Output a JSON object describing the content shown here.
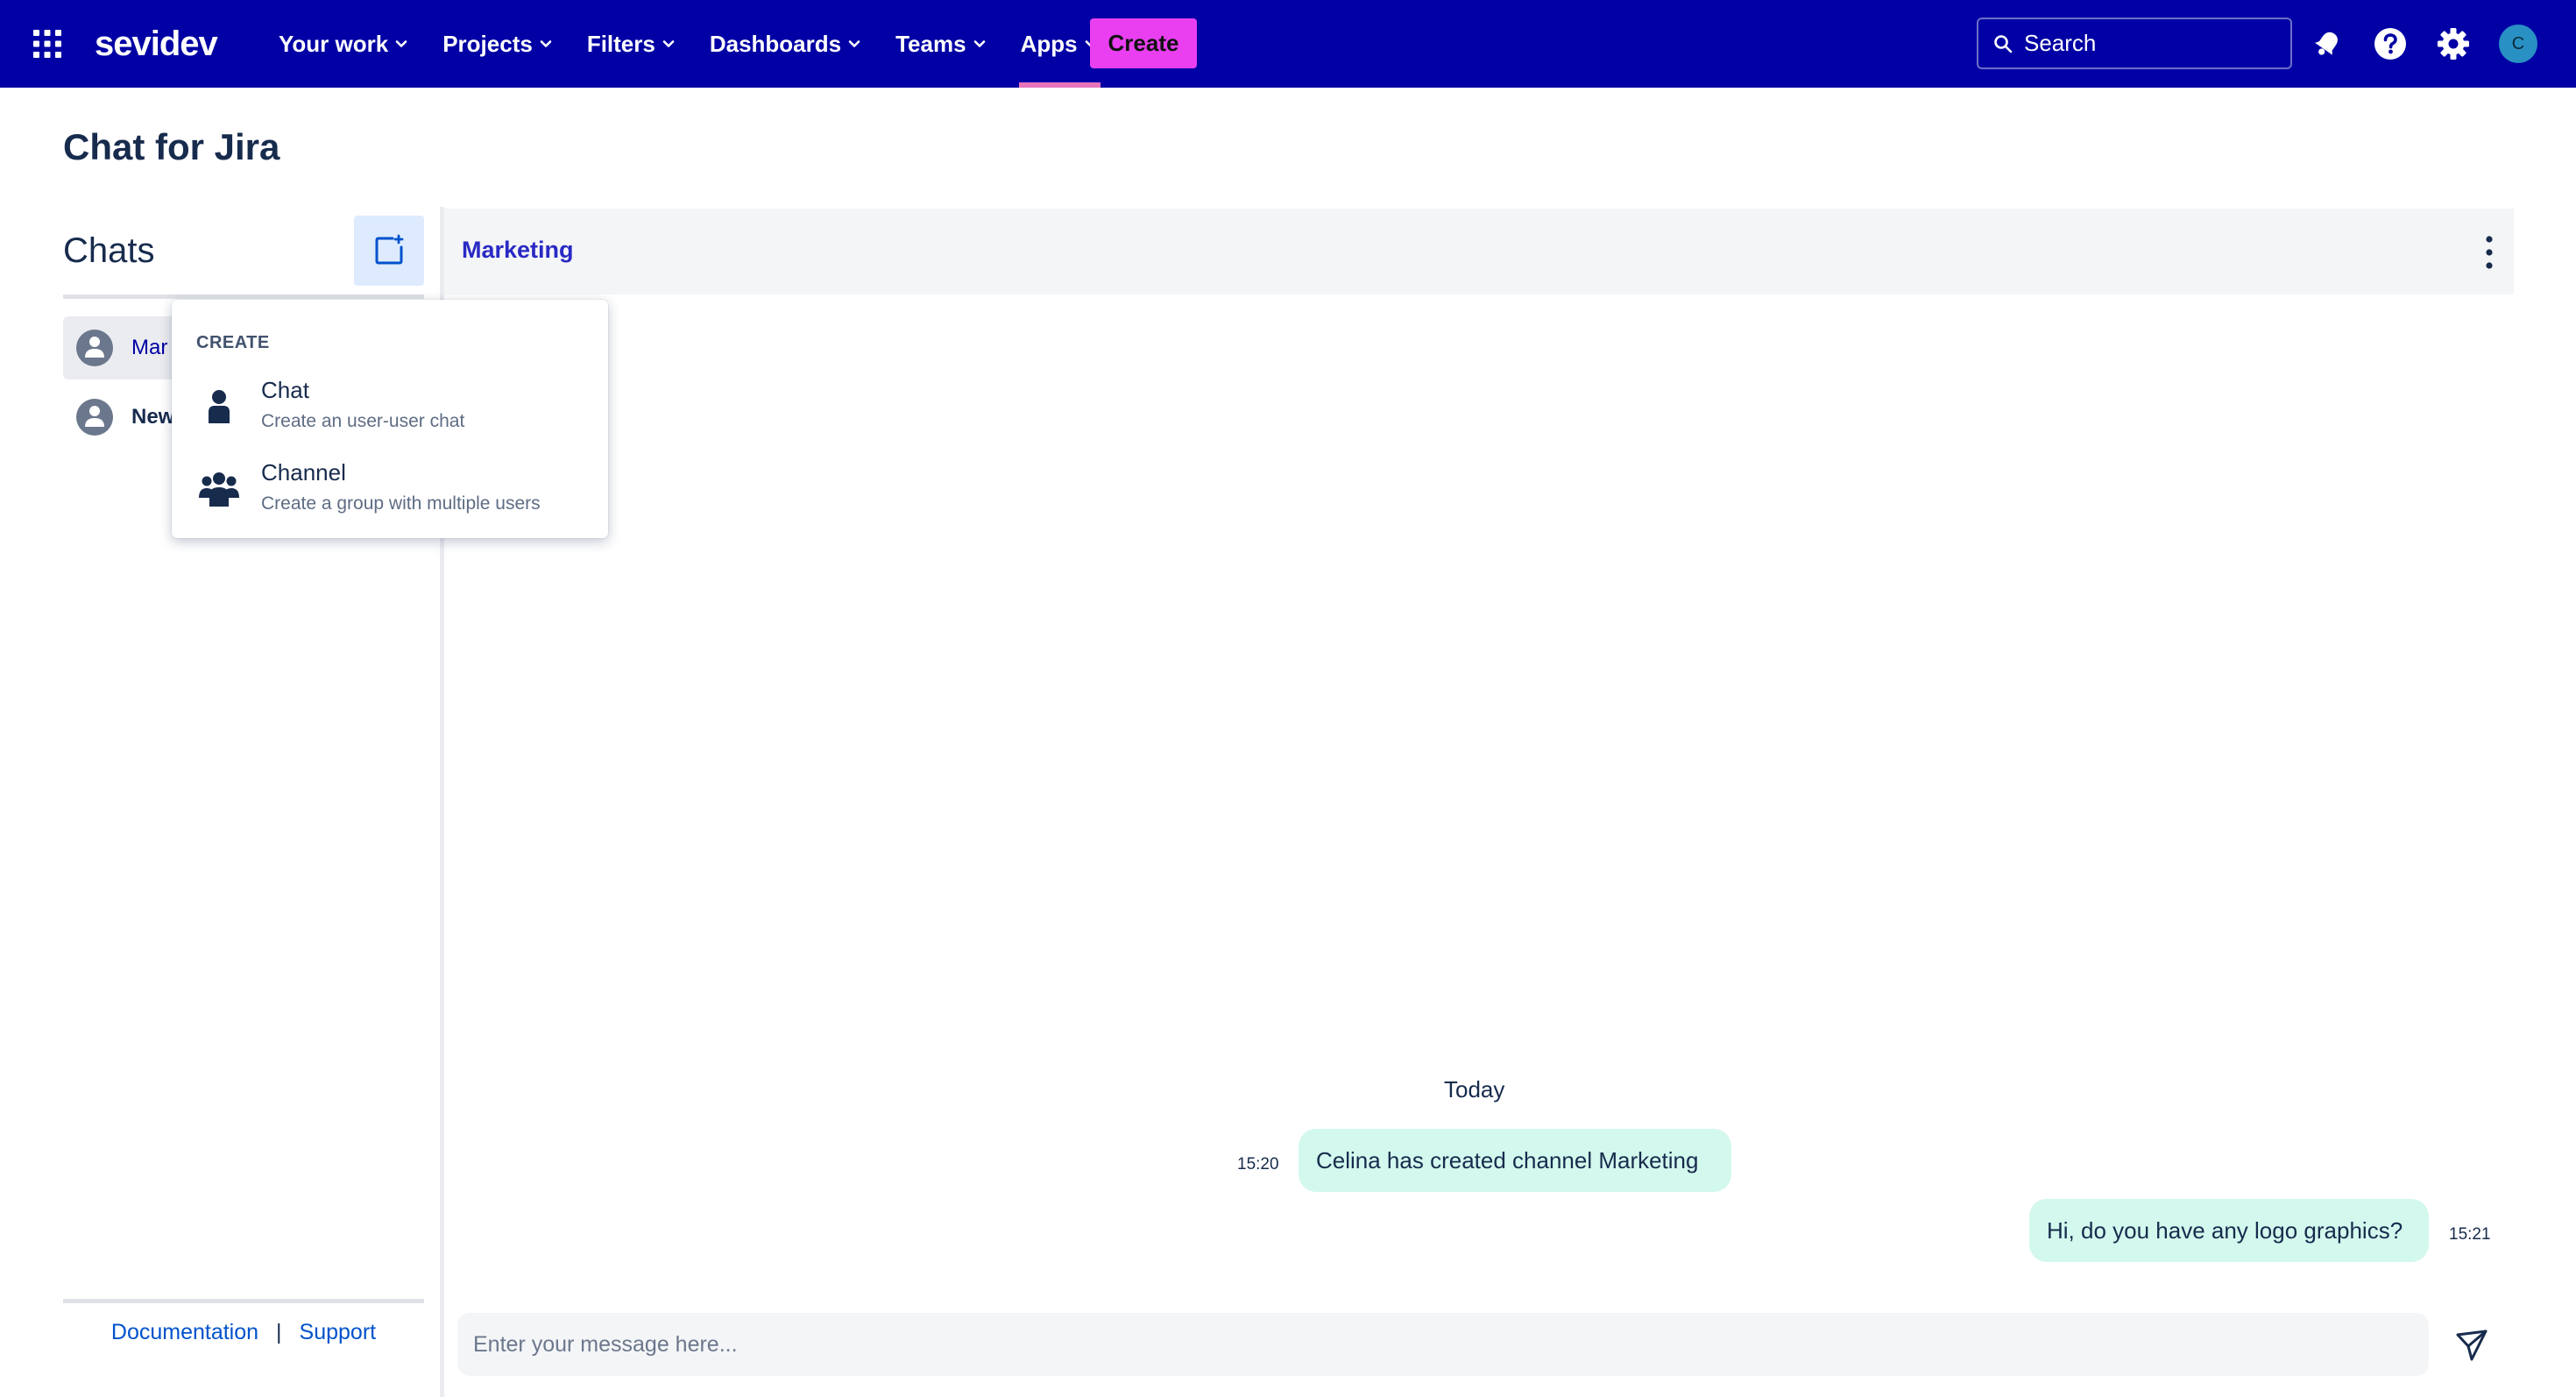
{
  "app": {
    "brand": "sevidev",
    "page_title": "Chat for Jira"
  },
  "nav": {
    "items": [
      {
        "label": "Your work"
      },
      {
        "label": "Projects"
      },
      {
        "label": "Filters"
      },
      {
        "label": "Dashboards"
      },
      {
        "label": "Teams"
      },
      {
        "label": "Apps",
        "active": true
      }
    ],
    "create_label": "Create",
    "search_placeholder": "Search",
    "avatar_initial": "C"
  },
  "sidebar": {
    "heading": "Chats",
    "items": [
      {
        "label": "Mar",
        "selected": true
      },
      {
        "label": "New",
        "selected": false
      }
    ],
    "footer": {
      "documentation": "Documentation",
      "separator": "|",
      "support": "Support"
    }
  },
  "create_menu": {
    "heading": "CREATE",
    "options": [
      {
        "title": "Chat",
        "description": "Create an user-user chat"
      },
      {
        "title": "Channel",
        "description": "Create a group with multiple users"
      }
    ]
  },
  "conversation": {
    "title": "Marketing",
    "day_label": "Today",
    "messages": [
      {
        "time": "15:20",
        "text": "Celina has created channel Marketing"
      },
      {
        "time": "15:21",
        "text": "Hi, do you have any logo graphics?"
      }
    ],
    "composer_placeholder": "Enter your message here..."
  },
  "colors": {
    "topbar": "#0000a4",
    "create_button": "#e93ff0",
    "active_nav_underline": "#e774bb",
    "bubble": "#d3f8ed",
    "link": "#0052cc"
  },
  "icons": [
    "app-switcher-icon",
    "chevron-down-icon",
    "search-icon",
    "notifications-icon",
    "help-icon",
    "settings-icon",
    "new-chat-icon",
    "collapse-chevron-icon",
    "user-avatar-icon",
    "person-icon",
    "people-group-icon",
    "more-vertical-icon",
    "send-icon"
  ]
}
